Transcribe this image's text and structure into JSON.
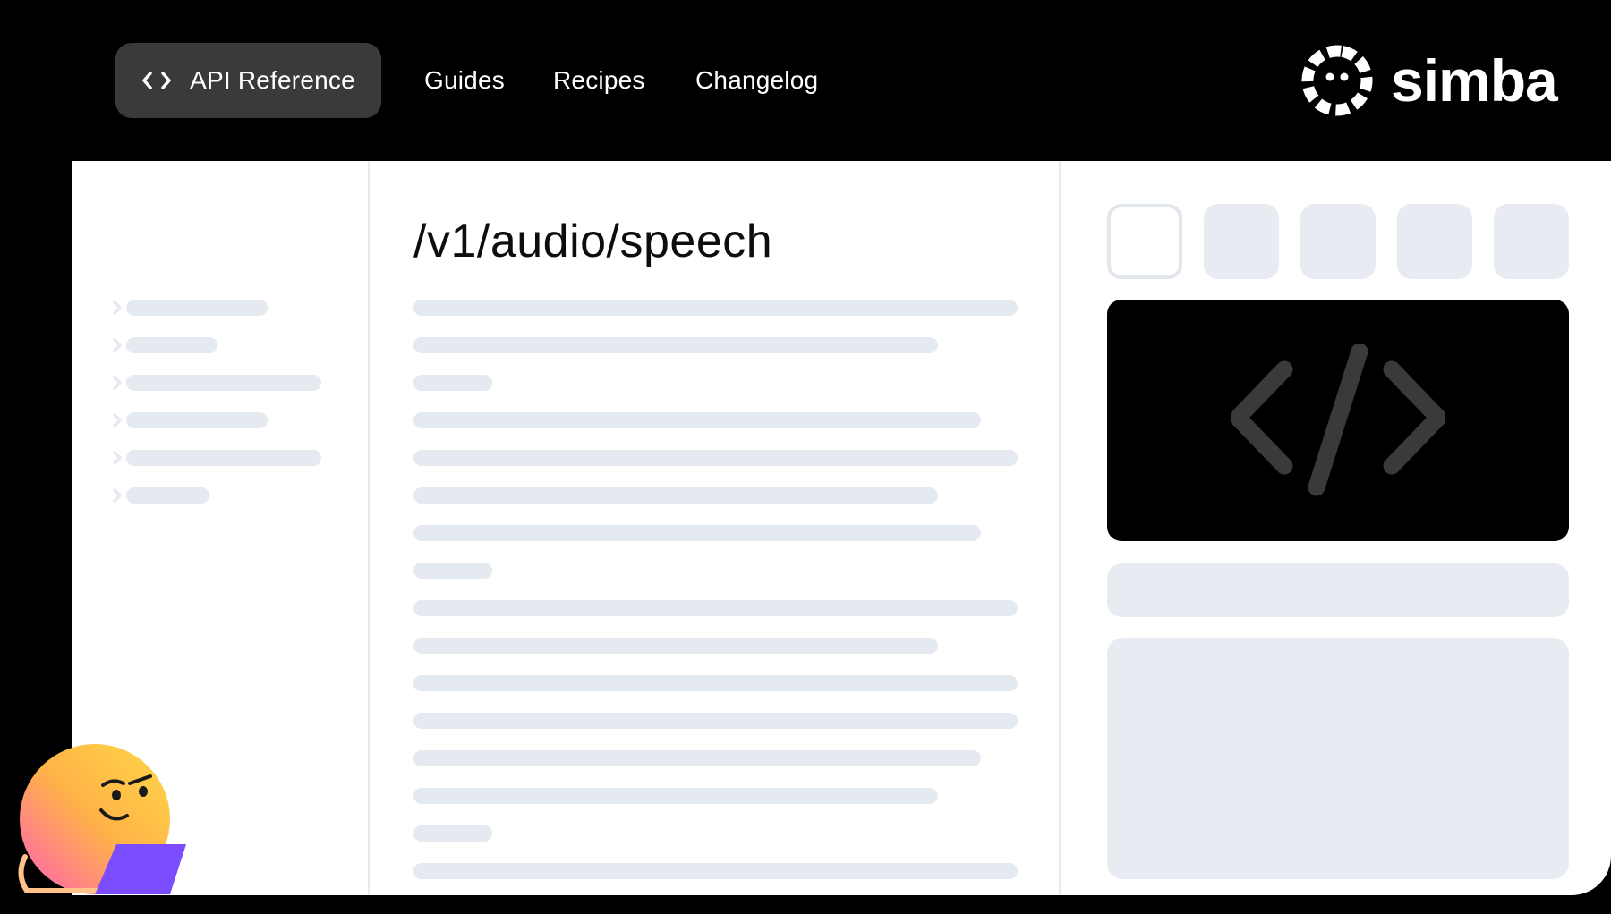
{
  "nav": {
    "items": [
      {
        "label": "API Reference",
        "active": true,
        "icon": "code-icon"
      },
      {
        "label": "Guides",
        "active": false
      },
      {
        "label": "Recipes",
        "active": false
      },
      {
        "label": "Changelog",
        "active": false
      }
    ]
  },
  "brand": {
    "name": "simba",
    "logo_icon": "face-ring-logo-icon"
  },
  "content": {
    "title": "/v1/audio/speech"
  },
  "code_panel": {
    "icon": "code-brackets-icon",
    "tabs_count": 5,
    "selected_tab": 1
  },
  "colors": {
    "background": "#000000",
    "panel": "#ffffff",
    "active_nav": "#3a3a3a",
    "placeholder": "#e5e9f0",
    "code_glyph": "#3a3a3a",
    "mascot_purple": "#7b4dff"
  }
}
